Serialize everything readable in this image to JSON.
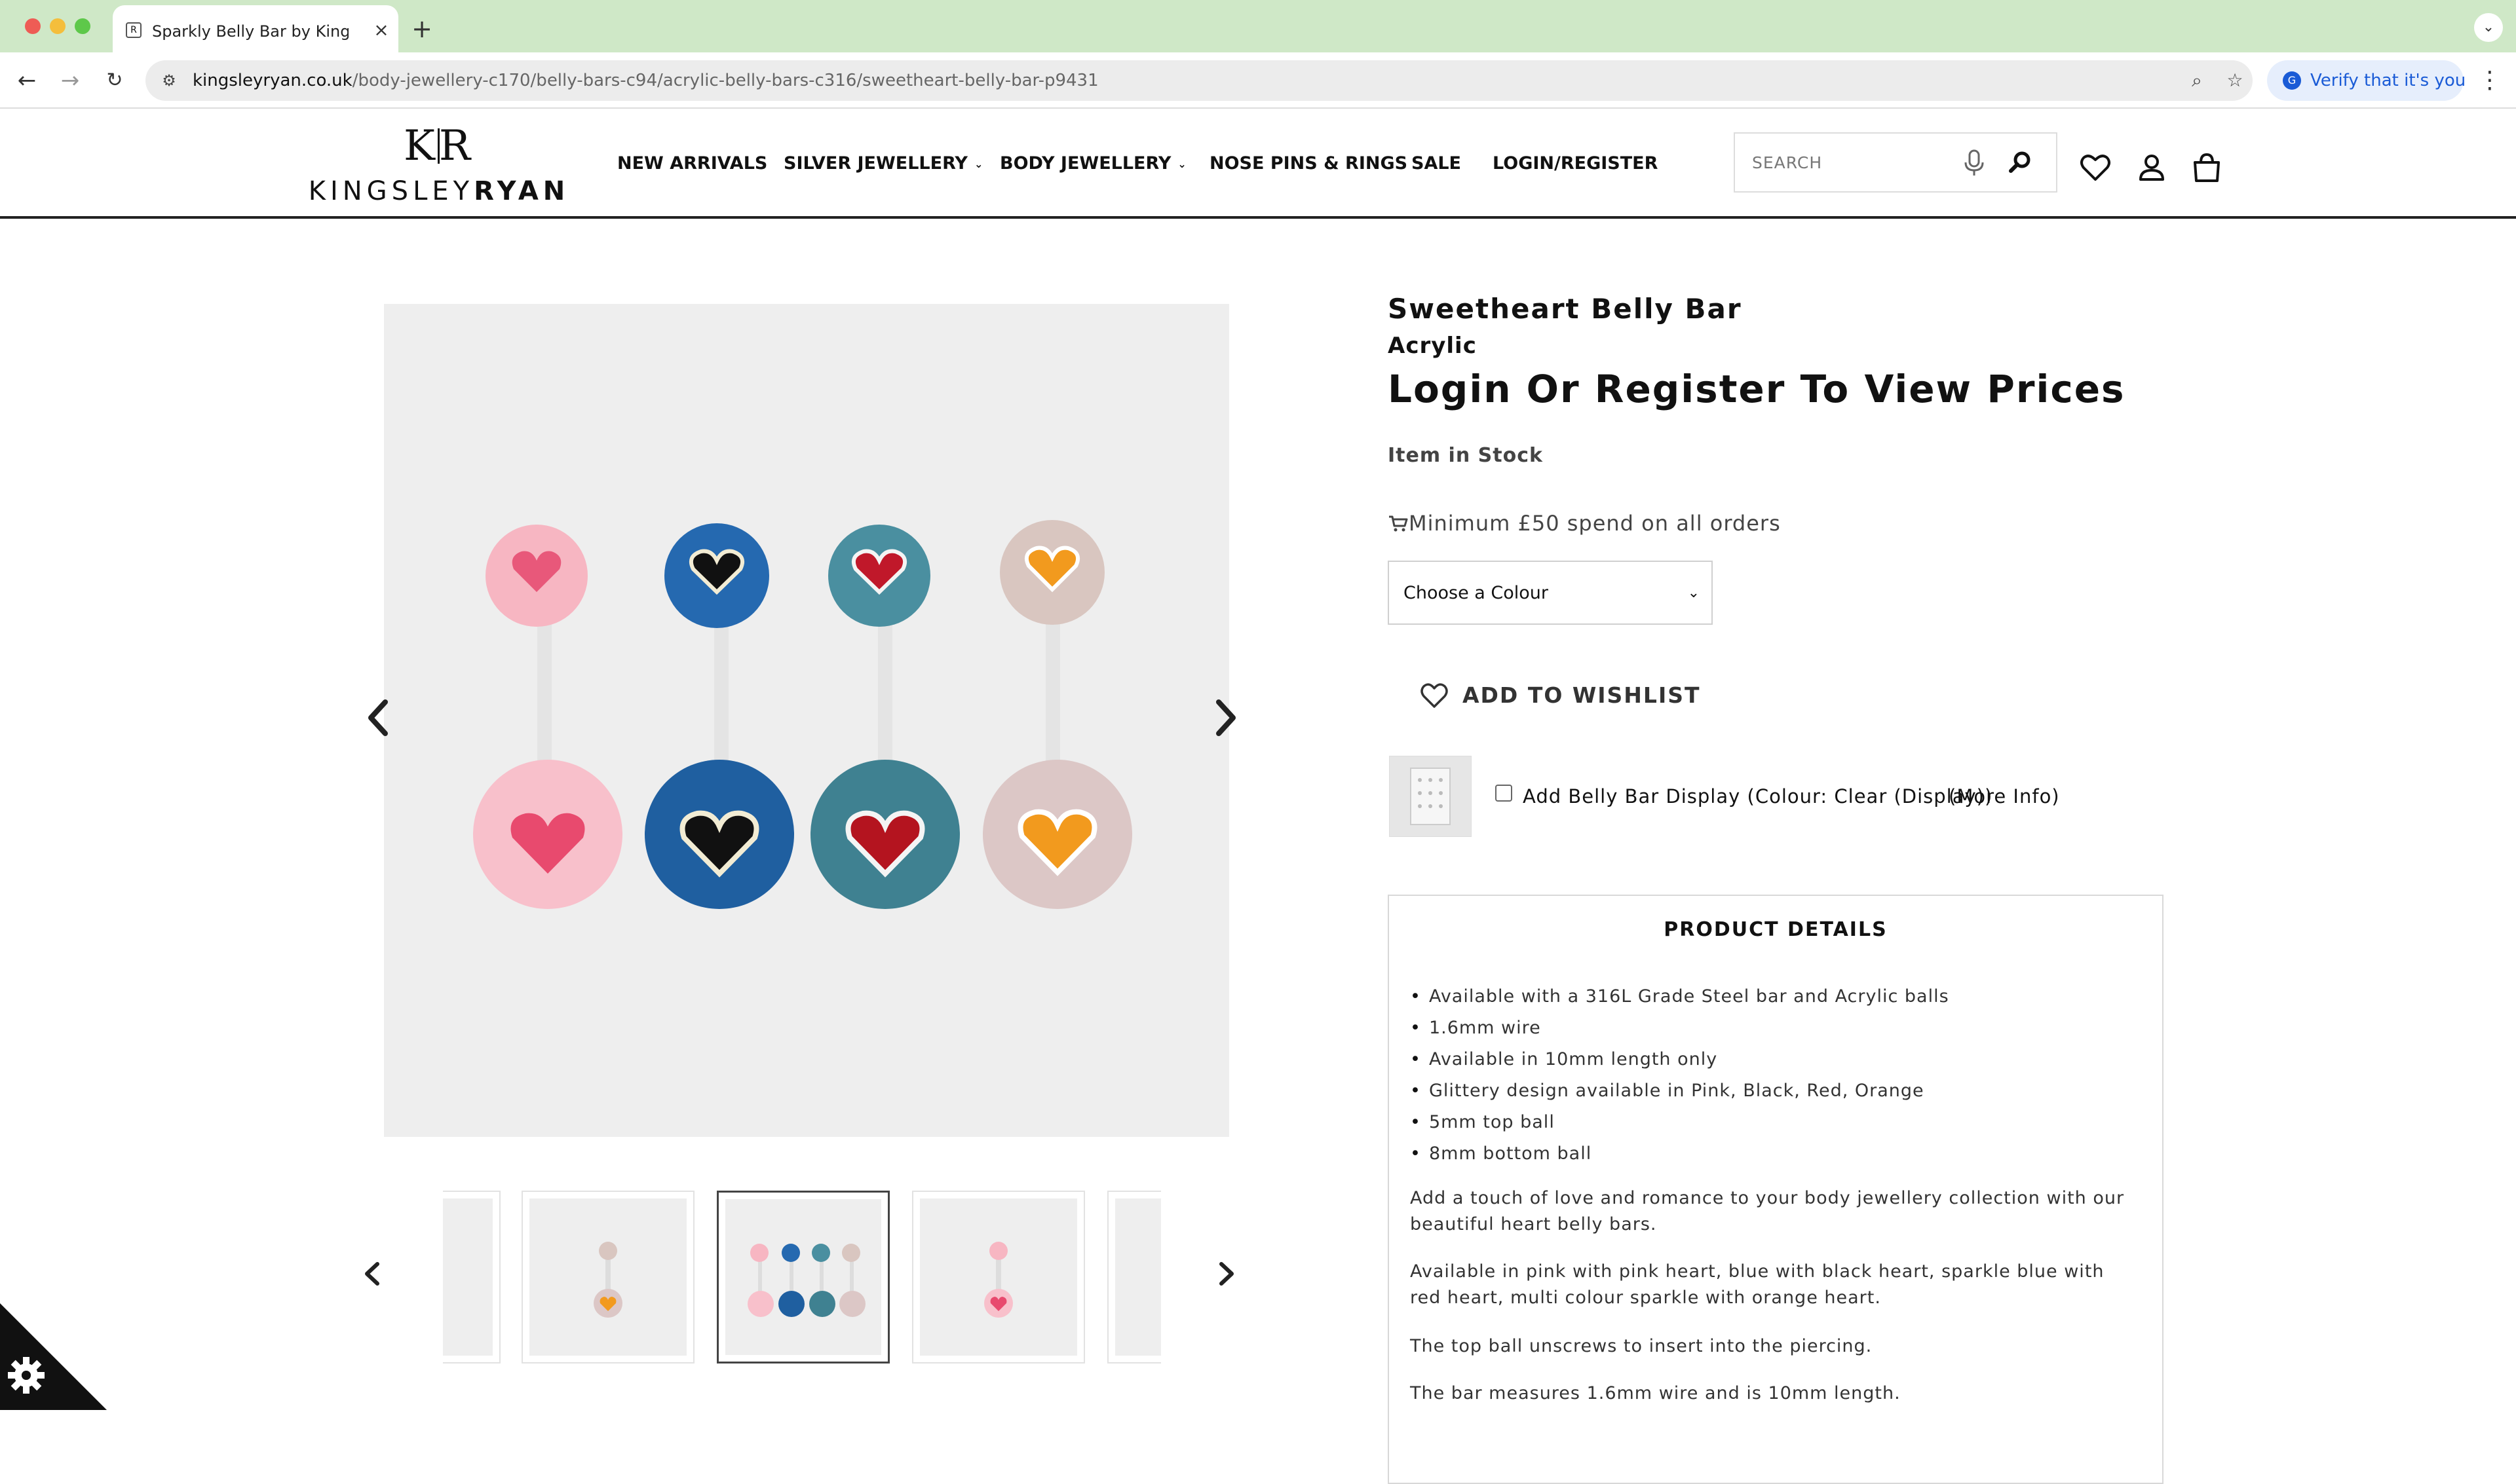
{
  "browser": {
    "tab_title": "Sparkly Belly Bar by Kingsley",
    "url_host": "kingsleyryan.co.uk",
    "url_path": "/body-jewellery-c170/belly-bars-c94/acrylic-belly-bars-c316/sweetheart-belly-bar-p9431",
    "verify_label": "Verify that it's you"
  },
  "header": {
    "logo_mark": "KR",
    "logo_word_light": "KINGSLEY",
    "logo_word_bold": "RYAN",
    "nav": [
      {
        "label": "NEW ARRIVALS",
        "dropdown": false
      },
      {
        "label": "SILVER JEWELLERY",
        "dropdown": true
      },
      {
        "label": "BODY JEWELLERY",
        "dropdown": true
      },
      {
        "label": "NOSE PINS & RINGS",
        "dropdown": false
      },
      {
        "label": "SALE",
        "dropdown": false
      },
      {
        "label": "LOGIN/REGISTER",
        "dropdown": false
      }
    ],
    "search_placeholder": "SEARCH"
  },
  "product": {
    "title": "Sweetheart Belly Bar",
    "subtitle": "Acrylic",
    "price_text": "Login Or Register To View Prices",
    "stock": "Item in Stock",
    "min_spend": "Minimum £50 spend on all orders",
    "colour_select": "Choose a Colour",
    "wishlist": "ADD TO WISHLIST",
    "addon_label": "Add Belly Bar Display (Colour: Clear (Display))",
    "addon_more": "(More Info)",
    "details_title": "PRODUCT DETAILS",
    "bullets": [
      "Available with a 316L Grade Steel bar and Acrylic balls",
      "1.6mm wire",
      "Available in 10mm length only",
      "Glittery design available in Pink, Black, Red, Orange",
      "5mm top ball",
      "8mm bottom ball"
    ],
    "paragraphs": [
      "Add a touch of love and romance to your body jewellery collection with our beautiful heart belly bars.",
      "Available in pink with pink heart, blue with black heart, sparkle blue with red heart, multi colour sparkle with orange heart.",
      "The top ball unscrews to insert into the piercing.",
      "The bar measures 1.6mm wire and is 10mm length."
    ]
  },
  "colors": {
    "tabbar_bg": "#cfe8c7",
    "pink": "#f08ea8",
    "blue": "#1f5fa0",
    "sparkle_blue": "#4a8fa0",
    "orange": "#f29a1e",
    "heart_red": "#c0182a"
  }
}
